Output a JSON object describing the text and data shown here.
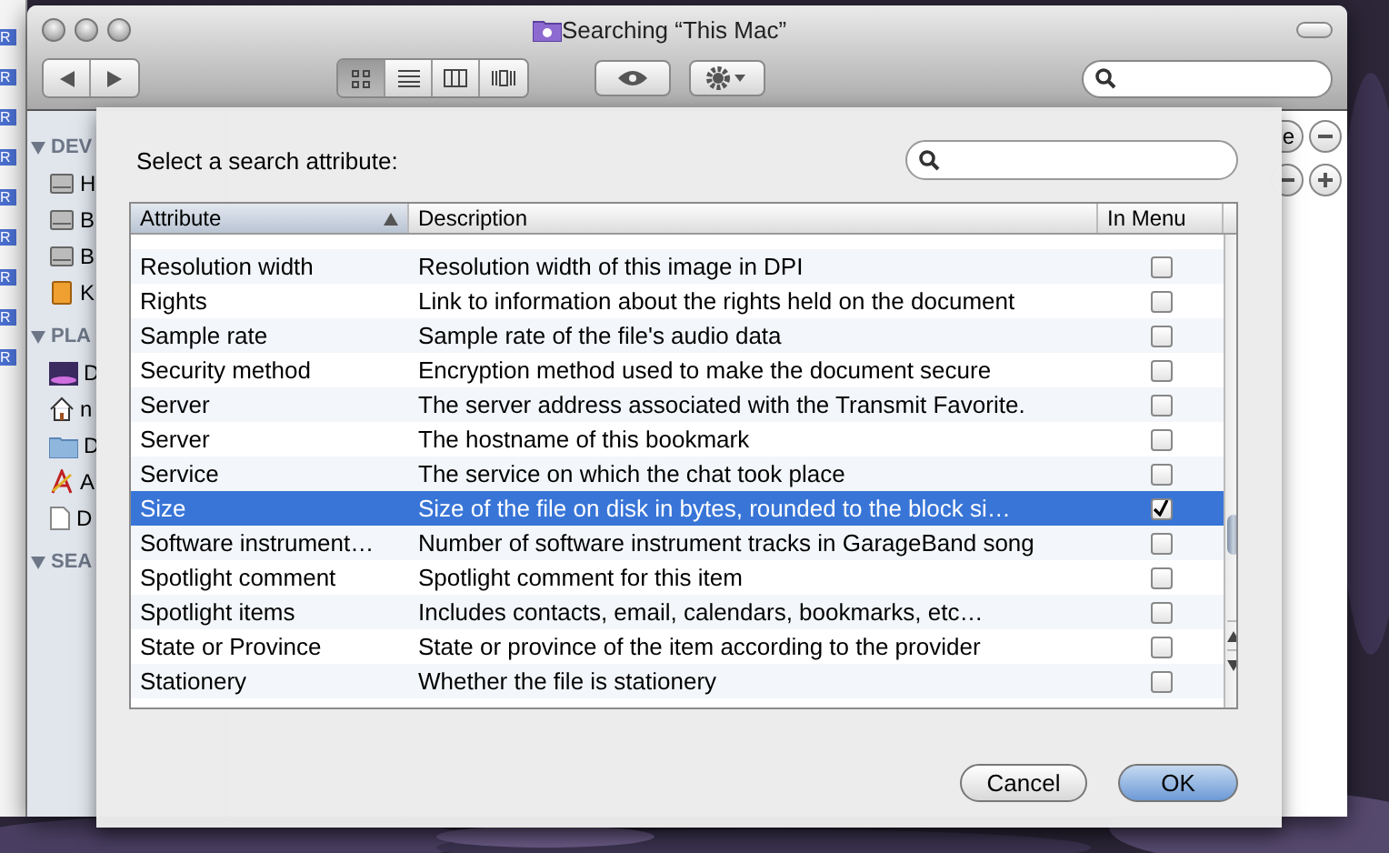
{
  "window": {
    "title": "Searching “This Mac”"
  },
  "desktop_tags": [
    "R",
    "R",
    "R",
    "R",
    "R",
    "R",
    "R",
    "R",
    "R"
  ],
  "toolbar": {
    "view_modes": [
      {
        "kind": "icons",
        "selected": true
      },
      {
        "kind": "list",
        "selected": false
      },
      {
        "kind": "columns",
        "selected": false
      },
      {
        "kind": "coverflow",
        "selected": false
      }
    ]
  },
  "sidebar": {
    "sections": [
      {
        "heading": "DEV",
        "items": [
          {
            "label": "H",
            "kind": "disk"
          },
          {
            "label": "B",
            "kind": "disk"
          },
          {
            "label": "B",
            "kind": "disk"
          },
          {
            "label": "K",
            "kind": "drive"
          }
        ]
      },
      {
        "heading": "PLA",
        "items": [
          {
            "label": "D",
            "kind": "desktop"
          },
          {
            "label": "n",
            "kind": "home"
          },
          {
            "label": "D",
            "kind": "folder"
          },
          {
            "label": "A",
            "kind": "apps"
          },
          {
            "label": "D",
            "kind": "document"
          }
        ]
      },
      {
        "heading": "SEA"
      }
    ]
  },
  "criteria_button": {
    "label": "e"
  },
  "dialog": {
    "prompt": "Select a search attribute:",
    "columns": [
      {
        "label": "Attribute",
        "sorted": true
      },
      {
        "label": "Description",
        "sorted": false
      },
      {
        "label": "In Menu",
        "sorted": false
      }
    ],
    "rows": [
      {
        "attribute": "Resolution width",
        "description": "Resolution width of this image in DPI",
        "in_menu": false,
        "selected": false
      },
      {
        "attribute": "Rights",
        "description": "Link to information about the rights held on the document",
        "in_menu": false,
        "selected": false
      },
      {
        "attribute": "Sample rate",
        "description": "Sample rate of the file's audio data",
        "in_menu": false,
        "selected": false
      },
      {
        "attribute": "Security method",
        "description": "Encryption method used to make the document secure",
        "in_menu": false,
        "selected": false
      },
      {
        "attribute": "Server",
        "description": "The server address associated with the Transmit Favorite.",
        "in_menu": false,
        "selected": false
      },
      {
        "attribute": "Server",
        "description": "The hostname of this bookmark",
        "in_menu": false,
        "selected": false
      },
      {
        "attribute": "Service",
        "description": "The service on which the chat took place",
        "in_menu": false,
        "selected": false
      },
      {
        "attribute": "Size",
        "description": "Size of the file on disk in bytes, rounded to the block si…",
        "in_menu": true,
        "selected": true
      },
      {
        "attribute": "Software instrument…",
        "description": "Number of software instrument tracks in GarageBand song",
        "in_menu": false,
        "selected": false
      },
      {
        "attribute": "Spotlight comment",
        "description": "Spotlight comment for this item",
        "in_menu": false,
        "selected": false
      },
      {
        "attribute": "Spotlight items",
        "description": "Includes contacts, email, calendars, bookmarks, etc…",
        "in_menu": false,
        "selected": false
      },
      {
        "attribute": "State or Province",
        "description": "State or province of the item according to the provider",
        "in_menu": false,
        "selected": false
      },
      {
        "attribute": "Stationery",
        "description": "Whether the file is stationery",
        "in_menu": false,
        "selected": false
      }
    ],
    "buttons": [
      {
        "label": "Cancel",
        "default": false
      },
      {
        "label": "OK",
        "default": true
      }
    ]
  }
}
